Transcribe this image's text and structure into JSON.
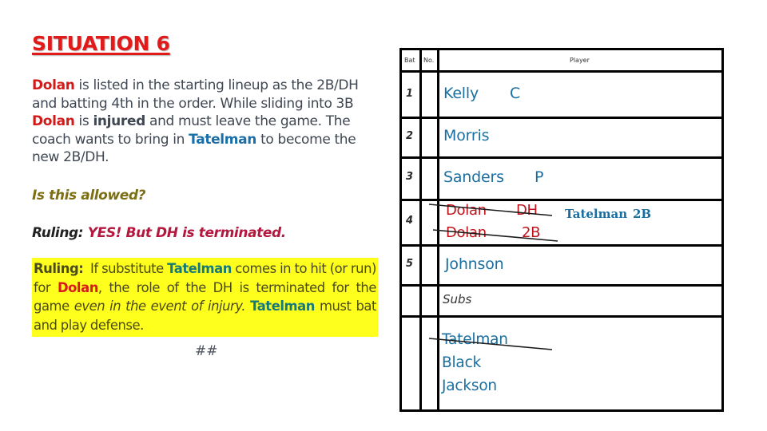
{
  "title": "SITUATION 6",
  "intro": {
    "segments": [
      {
        "text": "Dolan",
        "style": "red"
      },
      {
        "text": " is listed in the starting lineup as the 2B/DH and batting 4th in the order. While sliding into 3B ",
        "style": "plain"
      },
      {
        "text": "Dolan",
        "style": "red"
      },
      {
        "text": " is ",
        "style": "plain"
      },
      {
        "text": "injured",
        "style": "bold"
      },
      {
        "text": " and must leave the game. The coach wants to bring in ",
        "style": "plain"
      },
      {
        "text": "Tatelman",
        "style": "blue"
      },
      {
        "text": " to become the new 2B/DH.",
        "style": "plain"
      }
    ]
  },
  "question": "Is this allowed?",
  "ruling_short": {
    "label": "Ruling:",
    "value": "YES! But DH is terminated."
  },
  "ruling_detail": {
    "label": "Ruling:",
    "part1": "If substitute",
    "name1": "Tatelman",
    "part2": "comes in to hit (or run) for",
    "name2": "Dolan",
    "part3": ", the role of the DH is terminated for the game",
    "italic": "even in the event of injury.",
    "name3": "Tatelman",
    "part4": "must bat and play defense."
  },
  "footer_mark": "##",
  "lineup": {
    "headers": {
      "bat": "Bat",
      "no": "No.",
      "player": "Player"
    },
    "rows": [
      {
        "bat": "1",
        "player": "Kelly",
        "position": "C"
      },
      {
        "bat": "2",
        "player": "Morris",
        "position": ""
      },
      {
        "bat": "3",
        "player": "Sanders",
        "position": "P"
      },
      {
        "bat": "4",
        "entries": [
          {
            "player": "Dolan",
            "position": "DH",
            "struck": true
          },
          {
            "player": "Dolan",
            "position": "2B",
            "struck": true
          }
        ],
        "substitution": {
          "player": "Tatelman",
          "position": "2B"
        }
      },
      {
        "bat": "5",
        "player": "Johnson",
        "position": ""
      }
    ],
    "subs_label": "Subs",
    "subs": [
      {
        "player": "Tatelman",
        "struck": true
      },
      {
        "player": "Black",
        "struck": false
      },
      {
        "player": "Jackson",
        "struck": false
      }
    ]
  },
  "colors": {
    "title_red": "#e21a1a",
    "name_red": "#d11a1a",
    "name_blue": "#1a6fa8",
    "highlight_yellow": "#ffff1e",
    "question_olive": "#7b6e13",
    "ruling_crimson": "#b3173d",
    "lineup_blue": "#1a6fa0",
    "lineup_red": "#c0141c"
  }
}
